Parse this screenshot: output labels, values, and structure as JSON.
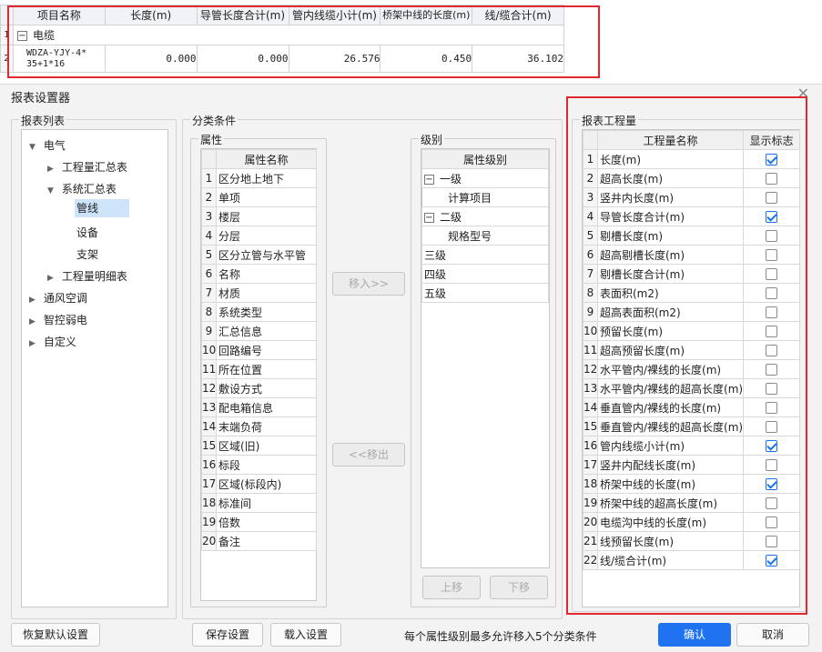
{
  "top_table": {
    "headers": [
      "项目名称",
      "长度(m)",
      "导管长度合计(m)",
      "管内线缆小计(m)",
      "桥架中线的长度(m)",
      "线/缆合计(m)"
    ],
    "group_index": "1",
    "group_label": "电缆",
    "row_index": "2",
    "row": {
      "name_line1": "WDZA-YJY-4*",
      "name_line2": "35+1*16",
      "values": [
        "0.000",
        "0.000",
        "26.576",
        "0.450",
        "36.102"
      ]
    }
  },
  "dialog": {
    "title": "报表设置器",
    "report_list": {
      "label": "报表列表",
      "items": [
        "电气",
        "工程量汇总表",
        "系统汇总表",
        "管线",
        "设备",
        "支架",
        "工程量明细表",
        "通风空调",
        "智控弱电",
        "自定义"
      ]
    },
    "classify": {
      "label": "分类条件",
      "attr_label": "属性",
      "attr_header": "属性名称",
      "attributes": [
        "区分地上地下",
        "单项",
        "楼层",
        "分层",
        "区分立管与水平管",
        "名称",
        "材质",
        "系统类型",
        "汇总信息",
        "回路编号",
        "所在位置",
        "敷设方式",
        "配电箱信息",
        "末端负荷",
        "区域(旧)",
        "标段",
        "区域(标段内)",
        "标准间",
        "倍数",
        "备注"
      ],
      "move_in": "移入>>",
      "move_out": "<<移出",
      "level_label": "级别",
      "level_header": "属性级别",
      "levels": [
        "一级",
        "计算项目",
        "二级",
        "规格型号",
        "三级",
        "四级",
        "五级"
      ],
      "move_up": "上移",
      "move_down": "下移"
    },
    "quantities": {
      "label": "报表工程量",
      "header_name": "工程量名称",
      "header_flag": "显示标志",
      "items": [
        {
          "name": "长度(m)",
          "checked": true
        },
        {
          "name": "超高长度(m)",
          "checked": false
        },
        {
          "name": "竖井内长度(m)",
          "checked": false
        },
        {
          "name": "导管长度合计(m)",
          "checked": true
        },
        {
          "name": "剔槽长度(m)",
          "checked": false
        },
        {
          "name": "超高剔槽长度(m)",
          "checked": false
        },
        {
          "name": "剔槽长度合计(m)",
          "checked": false
        },
        {
          "name": "表面积(m2)",
          "checked": false
        },
        {
          "name": "超高表面积(m2)",
          "checked": false
        },
        {
          "name": "预留长度(m)",
          "checked": false
        },
        {
          "name": "超高预留长度(m)",
          "checked": false
        },
        {
          "name": "水平管内/裸线的长度(m)",
          "checked": false
        },
        {
          "name": "水平管内/裸线的超高长度(m)",
          "checked": false
        },
        {
          "name": "垂直管内/裸线的长度(m)",
          "checked": false
        },
        {
          "name": "垂直管内/裸线的超高长度(m)",
          "checked": false
        },
        {
          "name": "管内线缆小计(m)",
          "checked": true
        },
        {
          "name": "竖井内配线长度(m)",
          "checked": false
        },
        {
          "name": "桥架中线的长度(m)",
          "checked": true
        },
        {
          "name": "桥架中线的超高长度(m)",
          "checked": false
        },
        {
          "name": "电缆沟中线的长度(m)",
          "checked": false
        },
        {
          "name": "线预留长度(m)",
          "checked": false
        },
        {
          "name": "线/缆合计(m)",
          "checked": true
        }
      ]
    },
    "footer": {
      "restore": "恢复默认设置",
      "save": "保存设置",
      "load": "载入设置",
      "hint": "每个属性级别最多允许移入5个分类条件",
      "ok": "确认",
      "cancel": "取消"
    },
    "colors": {
      "accent": "#1f72f0",
      "highlight": "#e0282e"
    }
  }
}
